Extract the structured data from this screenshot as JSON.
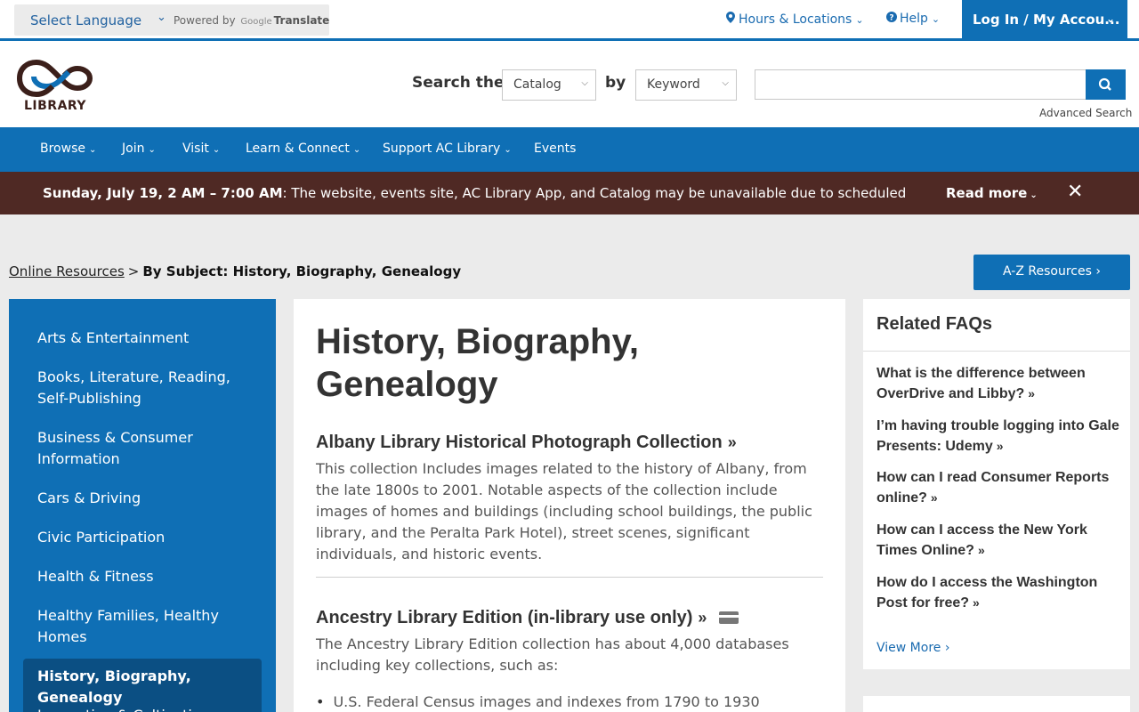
{
  "utility_bar": {
    "language_select": "Select Language",
    "powered_by": "Powered by",
    "google": "Google",
    "translate": "Translate",
    "hours_locations": "Hours & Locations",
    "help": "Help",
    "login": "Log In / My Accou..."
  },
  "header": {
    "logo_text": "LIBRARY",
    "search_label": "Search the",
    "scope_select": "Catalog",
    "by_label": "by",
    "type_select": "Keyword",
    "search_value": "",
    "advanced_search": "Advanced Search"
  },
  "nav": {
    "items": [
      {
        "label": "Browse"
      },
      {
        "label": "Join"
      },
      {
        "label": "Visit"
      },
      {
        "label": "Learn & Connect"
      },
      {
        "label": "Support AC Library"
      },
      {
        "label": "Events"
      }
    ]
  },
  "alert": {
    "bold": "Sunday, July 19, 2 AM – 7:00 AM",
    "text": ": The website, events site, AC Library App, and Catalog may be unavailable due to scheduled",
    "read_more": "Read more",
    "close": "✕"
  },
  "breadcrumb": {
    "parent": "Online Resources",
    "separator": ">",
    "current": "By Subject: History, Biography, Genealogy"
  },
  "az_button": "A-Z Resources",
  "sidebar": {
    "items": [
      {
        "label": "Arts & Entertainment"
      },
      {
        "label": "Books, Literature, Reading, Self-Publishing"
      },
      {
        "label": "Business & Consumer Information"
      },
      {
        "label": "Cars & Driving"
      },
      {
        "label": "Civic Participation"
      },
      {
        "label": "Health & Fitness"
      },
      {
        "label": "Healthy Families, Healthy Homes"
      },
      {
        "label": "History, Biography, Genealogy"
      },
      {
        "label": "Innovation & Cultivation"
      }
    ]
  },
  "main": {
    "title": "History, Biography, Genealogy",
    "resources": [
      {
        "title": "Albany Library Historical Photograph Collection",
        "description": "This collection Includes images related to the history of Albany, from the late 1800s to 2001. Notable aspects of the collection include images of homes and buildings (including school buildings, the public library, and the Peralta Park Hotel), street scenes, significant individuals, and historic events."
      },
      {
        "title": "Ancestry Library Edition (in-library use only)",
        "description": "The Ancestry Library Edition collection has about 4,000 databases including key collections, such as:",
        "bullets": [
          "U.S. Federal Census images and indexes from 1790 to 1930"
        ]
      }
    ]
  },
  "faqs": {
    "title": "Related FAQs",
    "items": [
      {
        "label": "What is the difference between OverDrive and Libby?"
      },
      {
        "label": "I’m having trouble logging into Gale Presents: Udemy"
      },
      {
        "label": "How can I read Consumer Reports online?"
      },
      {
        "label": "How can I access the New York Times Online?"
      },
      {
        "label": "How do I access the Washington Post for free?"
      }
    ],
    "view_more": "View More"
  },
  "colors": {
    "primary_blue": "#0f6fb5",
    "alert_brown": "#4f2924",
    "sidebar_active": "#0b4f83"
  }
}
